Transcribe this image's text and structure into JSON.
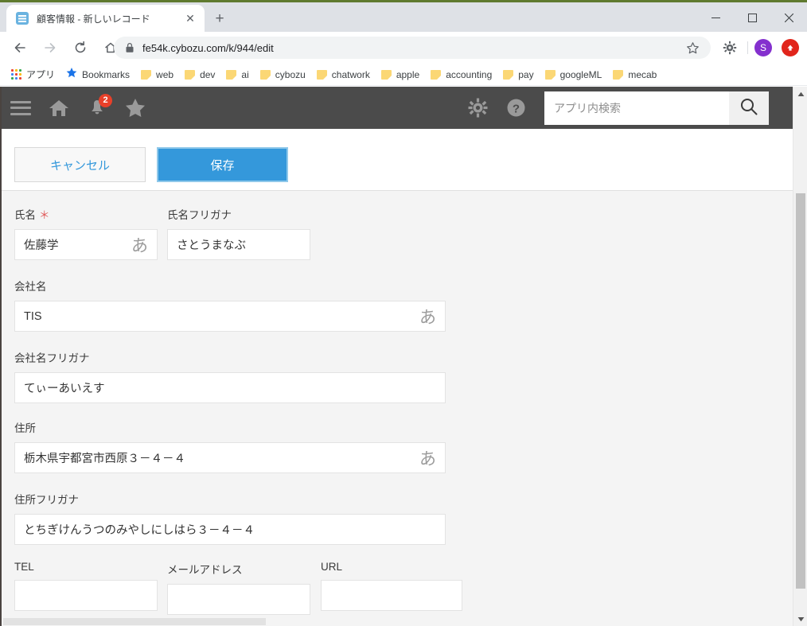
{
  "browser": {
    "tab": {
      "title": "顧客情報 - 新しいレコード",
      "close_label": "✕",
      "favicon_name": "kintone-favicon"
    },
    "newtab_label": "+",
    "window_controls": {
      "minimize": "minimize-icon",
      "maximize": "maximize-icon",
      "close": "close-icon"
    },
    "nav": {
      "back": "back-arrow-icon",
      "forward": "forward-arrow-icon",
      "reload": "reload-icon",
      "home": "home-icon"
    },
    "omnibox": {
      "url": "fe54k.cybozu.com/k/944/edit",
      "lock_icon": "lock-icon",
      "star_icon": "bookmark-star-icon"
    },
    "toolbar_right": {
      "extensions": "puzzle-icon",
      "profile_initial": "S",
      "update_icon": "update-arrow-icon"
    },
    "bookmarks": [
      {
        "label": "アプリ",
        "icon": "apps-grid-icon"
      },
      {
        "label": "Bookmarks",
        "icon": "star-icon"
      },
      {
        "label": "web",
        "icon": "folder-icon"
      },
      {
        "label": "dev",
        "icon": "folder-icon"
      },
      {
        "label": "ai",
        "icon": "folder-icon"
      },
      {
        "label": "cybozu",
        "icon": "folder-icon"
      },
      {
        "label": "chatwork",
        "icon": "folder-icon"
      },
      {
        "label": "apple",
        "icon": "folder-icon"
      },
      {
        "label": "accounting",
        "icon": "folder-icon"
      },
      {
        "label": "pay",
        "icon": "folder-icon"
      },
      {
        "label": "googleML",
        "icon": "folder-icon"
      },
      {
        "label": "mecab",
        "icon": "folder-icon"
      }
    ]
  },
  "app_header": {
    "menu_icon": "hamburger-menu-icon",
    "home_icon": "home-icon",
    "bell_icon": "notification-bell-icon",
    "bell_badge": "2",
    "star_icon": "favorites-star-icon",
    "gear_icon": "settings-gear-icon",
    "help_icon": "help-question-icon",
    "search_placeholder": "アプリ内検索",
    "search_value": "",
    "search_button_icon": "search-magnifier-icon",
    "bg_color": "#4b4b4b"
  },
  "actions": {
    "cancel_label": "キャンセル",
    "save_label": "保存",
    "save_color": "#3498db"
  },
  "form": {
    "fields": [
      {
        "label": "氏名",
        "required": true,
        "value": "佐藤学",
        "ime": "あ",
        "name": "name"
      },
      {
        "label": "氏名フリガナ",
        "required": false,
        "value": "さとうまなぶ",
        "ime": "",
        "name": "name-furigana"
      },
      {
        "label": "会社名",
        "required": false,
        "value": "TIS",
        "ime": "あ",
        "name": "company"
      },
      {
        "label": "会社名フリガナ",
        "required": false,
        "value": "てぃーあいえす",
        "ime": "",
        "name": "company-furigana"
      },
      {
        "label": "住所",
        "required": false,
        "value": "栃木県宇都宮市西原３－４－４",
        "ime": "あ",
        "name": "address"
      },
      {
        "label": "住所フリガナ",
        "required": false,
        "value": "とちぎけんうつのみやしにしはら３－４－４",
        "ime": "",
        "name": "address-furigana"
      },
      {
        "label": "TEL",
        "required": false,
        "value": "",
        "ime": "",
        "name": "tel"
      },
      {
        "label": "メールアドレス",
        "required": false,
        "value": "",
        "ime": "",
        "name": "email"
      },
      {
        "label": "URL",
        "required": false,
        "value": "",
        "ime": "",
        "name": "url"
      }
    ],
    "required_marker": "＊"
  }
}
